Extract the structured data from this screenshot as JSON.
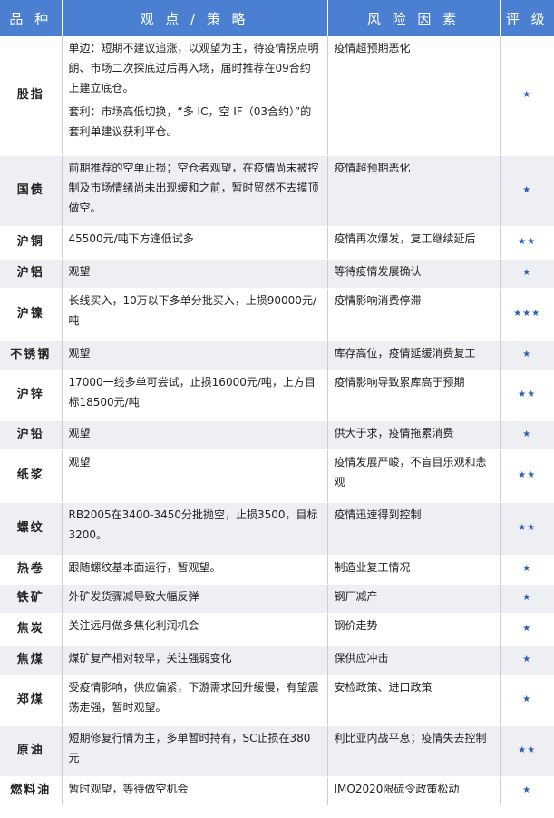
{
  "header": {
    "variety": "品 种",
    "strategy": "观 点 / 策 略",
    "risk": "风 险 因 素",
    "rating": "评 级"
  },
  "rows": [
    {
      "name": "股指",
      "strategy": [
        "单边：短期不建议追涨，以观望为主，待疫情拐点明朗、市场二次探底过后再入场，届时推荐在09合约上建立底仓。",
        "套利：市场高低切换，“多 IC，空 IF（03合约）”的套利单建议获利平仓。"
      ],
      "risk": "疫情超预期恶化",
      "rating": "★"
    },
    {
      "name": "国债",
      "strategy": [
        "前期推荐的空单止损；空仓者观望，在疫情尚未被控制及市场情绪尚未出现缓和之前，暂时贸然不去摸顶做空。"
      ],
      "risk": "疫情超预期恶化",
      "rating": "★"
    },
    {
      "name": "沪铜",
      "strategy": [
        "45500元/吨下方逢低试多"
      ],
      "risk": "疫情再次爆发，复工继续延后",
      "rating": "★★"
    },
    {
      "name": "沪铝",
      "strategy": [
        "观望"
      ],
      "risk": "等待疫情发展确认",
      "rating": "★"
    },
    {
      "name": "沪镍",
      "strategy": [
        "长线买入，10万以下多单分批买入，止损90000元/吨"
      ],
      "risk": "疫情影响消费停滞",
      "rating": "★★★"
    },
    {
      "name": "不锈钢",
      "strategy": [
        "观望"
      ],
      "risk": "库存高位，疫情延缓消费复工",
      "rating": "★"
    },
    {
      "name": "沪锌",
      "strategy": [
        "17000一线多单可尝试，止损16000元/吨，上方目标18500元/吨"
      ],
      "risk": "疫情影响导致累库高于预期",
      "rating": "★★"
    },
    {
      "name": "沪铅",
      "strategy": [
        "观望"
      ],
      "risk": "供大于求，疫情拖累消费",
      "rating": "★"
    },
    {
      "name": "纸浆",
      "strategy": [
        "观望"
      ],
      "risk": "疫情发展严峻，不盲目乐观和悲观",
      "rating": "★★"
    },
    {
      "name": "螺纹",
      "strategy": [
        "RB2005在3400-3450分批抛空，止损3500，目标3200。"
      ],
      "risk": "疫情迅速得到控制",
      "rating": "★★"
    },
    {
      "name": "热卷",
      "strategy": [
        "跟随螺纹基本面运行，暂观望。"
      ],
      "risk": "制造业复工情况",
      "rating": "★"
    },
    {
      "name": "铁矿",
      "strategy": [
        "外矿发货骤减导致大幅反弹"
      ],
      "risk": "钢厂减产",
      "rating": "★"
    },
    {
      "name": "焦炭",
      "strategy": [
        "关注远月做多焦化利润机会"
      ],
      "risk": "钢价走势",
      "rating": "★"
    },
    {
      "name": "焦煤",
      "strategy": [
        "煤矿复产相对较早，关注强弱变化"
      ],
      "risk": "保供应冲击",
      "rating": "★"
    },
    {
      "name": "郑煤",
      "strategy": [
        "受疫情影响，供应偏紧，下游需求回升缓慢，有望震荡走强，暂时观望。"
      ],
      "risk": "安检政策、进口政策",
      "rating": "★"
    },
    {
      "name": "原油",
      "strategy": [
        "短期修复行情为主，多单暂时持有，SC止损在380元"
      ],
      "risk": "利比亚内战平息；疫情失去控制",
      "rating": "★★"
    },
    {
      "name": "燃料油",
      "strategy": [
        "暂时观望，等待做空机会"
      ],
      "risk": "IMO2020限硫令政策松动",
      "rating": "★"
    }
  ]
}
